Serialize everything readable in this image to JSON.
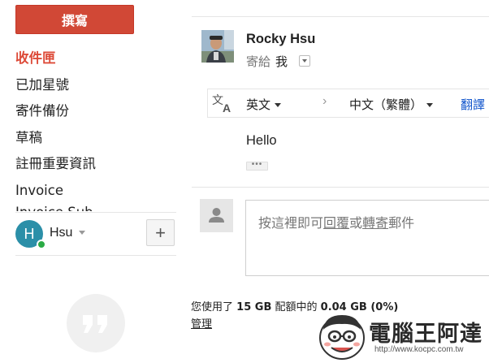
{
  "sidebar": {
    "compose_label": "撰寫",
    "items": [
      {
        "label": "收件匣",
        "active": true
      },
      {
        "label": "已加星號",
        "active": false
      },
      {
        "label": "寄件備份",
        "active": false
      },
      {
        "label": "草稿",
        "active": false
      },
      {
        "label": "註冊重要資訊",
        "active": false
      },
      {
        "label": "Invoice",
        "active": false
      }
    ],
    "clipped_item": "Invoice Sub"
  },
  "hangouts": {
    "avatar_letter": "H",
    "user_name": "Hsu",
    "add_label": "+",
    "avatar_color": "#2b8fa8",
    "status_color": "#2bab45",
    "bubble_icon": "hangouts-quote-icon"
  },
  "message": {
    "sender_name": "Rocky Hsu",
    "to_prefix": "寄給",
    "to_value": "我",
    "body": "Hello",
    "trim_label": "•••"
  },
  "translate": {
    "icon": "translate-icon",
    "from_lang": "英文",
    "arrow": "›",
    "to_lang": "中文（繁體）",
    "action_label": "翻譯"
  },
  "reply": {
    "prompt_prefix": "按這裡即可",
    "reply_word": "回覆",
    "or_word": "或",
    "forward_word": "轉寄",
    "prompt_suffix": "郵件"
  },
  "footer": {
    "quota_prefix": "您使用了",
    "quota_total": "15 GB",
    "quota_middle": "配額中的",
    "quota_used": "0.04 GB (0%)",
    "manage_label": "管理"
  },
  "watermark": {
    "title": "電腦王阿達",
    "url": "http://www.kocpc.com.tw"
  },
  "colors": {
    "compose": "#d14836",
    "active_nav": "#dd4b39",
    "link": "#1155cc"
  }
}
